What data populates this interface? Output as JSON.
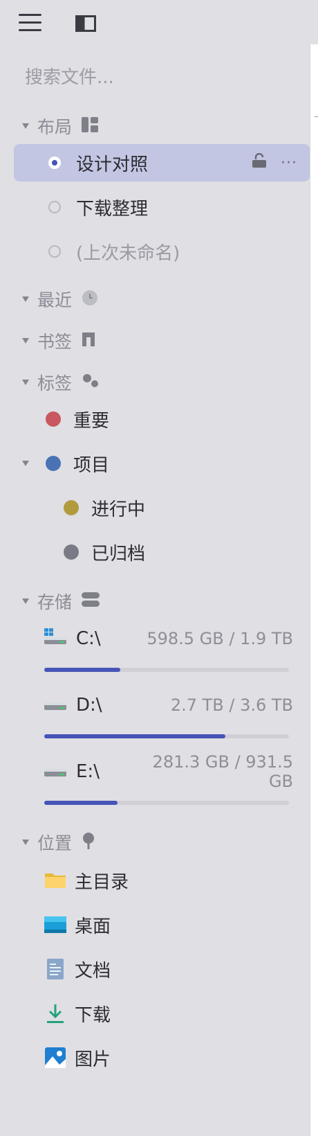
{
  "toolbar": {
    "menu_icon": "hamburger-icon",
    "panel_icon": "sidebar-panel-icon"
  },
  "search": {
    "placeholder": "搜索文件..."
  },
  "layouts": {
    "title": "布局",
    "items": [
      {
        "label": "设计对照",
        "selected": true
      },
      {
        "label": "下载整理",
        "selected": false
      },
      {
        "label": "(上次未命名)",
        "selected": false
      }
    ]
  },
  "recent": {
    "title": "最近"
  },
  "bookmarks": {
    "title": "书签"
  },
  "tags": {
    "title": "标签",
    "items": [
      {
        "label": "重要",
        "color": "#c9575f"
      },
      {
        "label": "项目",
        "color": "#4a72b5"
      },
      {
        "label": "进行中",
        "color": "#b29b3e"
      },
      {
        "label": "已归档",
        "color": "#7a7a86"
      }
    ]
  },
  "storage": {
    "title": "存储",
    "drives": [
      {
        "label": "C:\\",
        "size": "598.5 GB / 1.9 TB",
        "used_fraction": 0.31
      },
      {
        "label": "D:\\",
        "size": "2.7 TB / 3.6 TB",
        "used_fraction": 0.74
      },
      {
        "label": "E:\\",
        "size": "281.3 GB / 931.5 GB",
        "used_fraction": 0.3
      }
    ]
  },
  "locations": {
    "title": "位置",
    "items": [
      {
        "label": "主目录",
        "icon": "folder-icon"
      },
      {
        "label": "桌面",
        "icon": "desktop-icon"
      },
      {
        "label": "文档",
        "icon": "document-icon"
      },
      {
        "label": "下载",
        "icon": "download-icon"
      },
      {
        "label": "图片",
        "icon": "pictures-icon"
      }
    ]
  },
  "colors": {
    "accent": "#4654b8",
    "selection": "#c2c6e2",
    "sidebar_bg": "#dfdfe4"
  }
}
